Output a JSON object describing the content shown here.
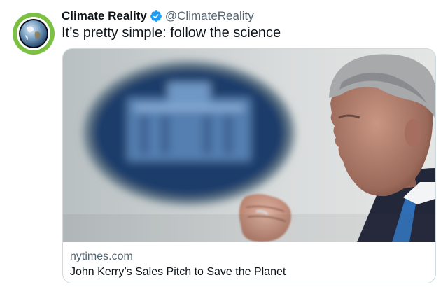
{
  "tweet": {
    "author_name": "Climate Reality",
    "author_handle": "@ClimateReality",
    "verified": true,
    "text": "It’s pretty simple: follow the science"
  },
  "card": {
    "domain": "nytimes.com",
    "title": "John Kerry’s Sales Pitch to Save the Planet"
  },
  "icons": {
    "avatar": "earth-globe-icon",
    "verified": "verified-badge-icon"
  },
  "colors": {
    "avatar_ring": "#7bc043",
    "verified": "#1d9bf0",
    "handle": "#536471",
    "text": "#0f1419",
    "card_border": "#cfd9de"
  }
}
